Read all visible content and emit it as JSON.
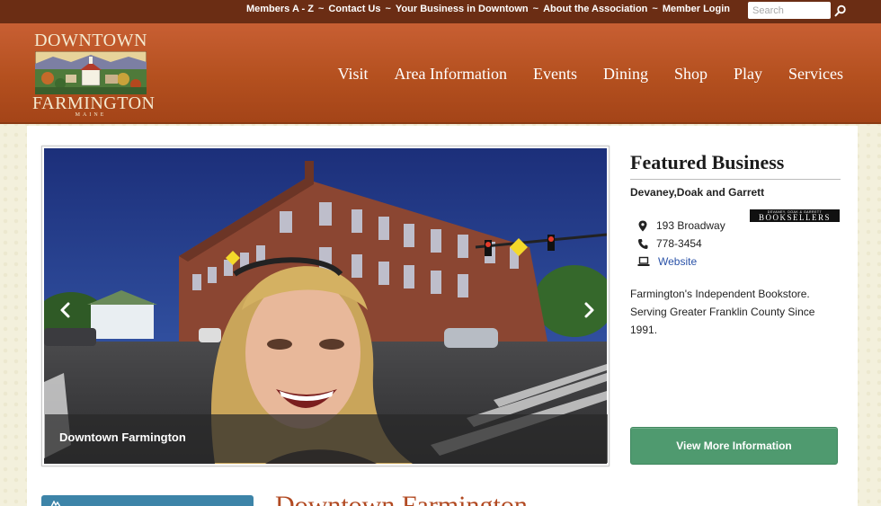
{
  "topbar": {
    "links": [
      "Members A - Z",
      "Contact Us",
      "Your Business in Downtown",
      "About the Association",
      "Member Login"
    ],
    "separator": "~",
    "search_placeholder": "Search"
  },
  "logo": {
    "top": "DOWNTOWN",
    "bottom": "FARMINGTON",
    "state": "MAINE"
  },
  "nav": {
    "items": [
      "Visit",
      "Area Information",
      "Events",
      "Dining",
      "Shop",
      "Play",
      "Services"
    ]
  },
  "slider": {
    "caption": "Downtown Farmington"
  },
  "featured": {
    "heading": "Featured Business",
    "name": "Devaney,Doak and Garrett",
    "logo_small": "DEVANEY, DOAK & GARRETT",
    "logo_big": "BOOKSELLERS",
    "address": "193 Broadway",
    "phone": "778-3454",
    "website_label": "Website",
    "description": "Farmington's Independent Bookstore. Serving Greater Franklin County Since 1991.",
    "button": "View More Information"
  },
  "bottom": {
    "heading": "Downtown Farmington"
  },
  "colors": {
    "topbar": "#6b2d14",
    "header": "#b4501f",
    "button_green": "#4f9a6f",
    "link_blue": "#2a52a8",
    "accent_blue": "#3d84a8"
  },
  "icons": [
    "search-icon",
    "chevron-left-icon",
    "chevron-right-icon",
    "map-pin-icon",
    "phone-icon",
    "laptop-icon"
  ]
}
